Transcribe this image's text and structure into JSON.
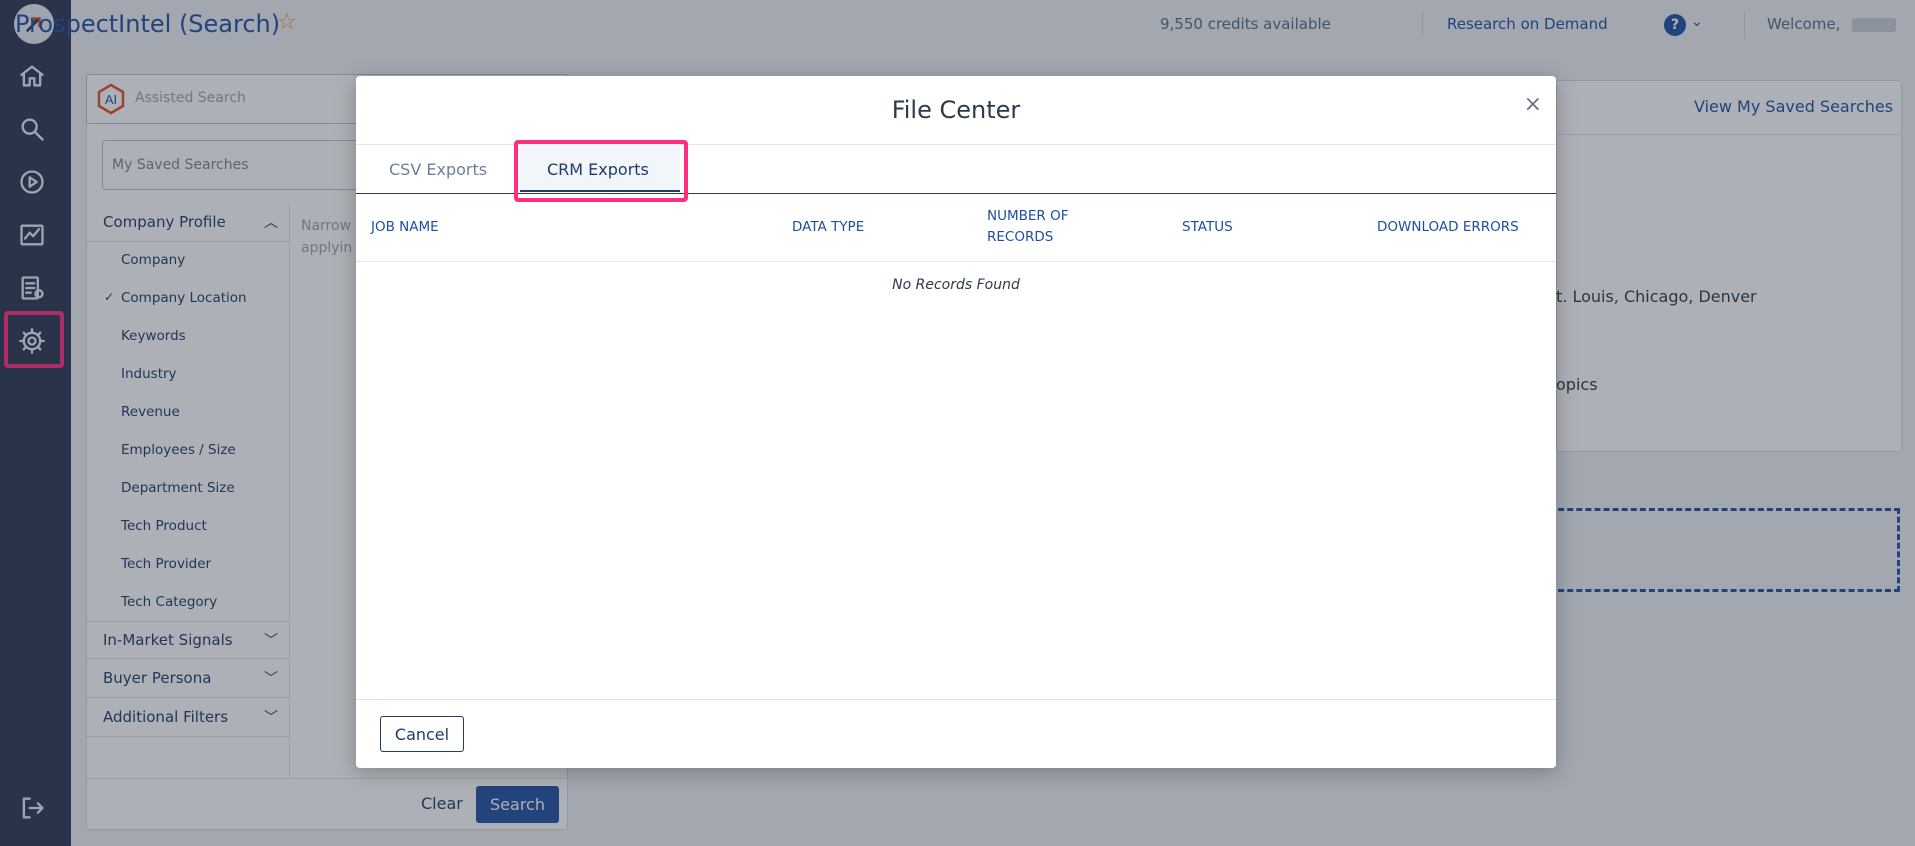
{
  "header": {
    "title": "ProspectIntel (Search)",
    "credits": "9,550 credits available",
    "research_link": "Research on Demand",
    "help_glyph": "?",
    "welcome": "Welcome,"
  },
  "search_panel": {
    "assisted_search_placeholder": "Assisted Search",
    "saved_searches_placeholder": "My Saved Searches",
    "sections": {
      "company_profile": "Company Profile",
      "in_market": "In-Market Signals",
      "buyer_persona": "Buyer Persona",
      "additional": "Additional Filters"
    },
    "company_items": [
      "Company",
      "Company Location",
      "Keywords",
      "Industry",
      "Revenue",
      "Employees / Size",
      "Department Size",
      "Tech Product",
      "Tech Provider",
      "Tech Category"
    ],
    "narrow_text_1": "Narrow",
    "narrow_text_2": "applyin",
    "clear_label": "Clear",
    "search_label": "Search"
  },
  "right_panel": {
    "view_saved": "View My Saved Searches",
    "text_locations": "t. Louis, Chicago, Denver",
    "text_topics": "opics"
  },
  "modal": {
    "title": "File Center",
    "close_glyph": "×",
    "tabs": {
      "csv": "CSV Exports",
      "crm": "CRM Exports"
    },
    "columns": {
      "job_name": "JOB NAME",
      "data_type": "DATA TYPE",
      "records_1": "NUMBER OF",
      "records_2": "RECORDS",
      "status": "STATUS",
      "download_errors": "DOWNLOAD ERRORS"
    },
    "empty_message": "No Records Found",
    "cancel_label": "Cancel"
  },
  "colors": {
    "rail": "#2a3650",
    "brand_blue": "#1f4fa0",
    "highlight": "#ff2e7e",
    "star": "#e8a317"
  }
}
